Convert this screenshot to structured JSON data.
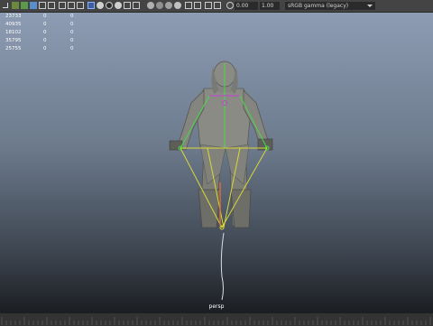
{
  "toolbar": {
    "near_clip": "0.00",
    "far_clip": "1.00",
    "color_space": "sRGB gamma (legacy)"
  },
  "hud": {
    "rows": [
      {
        "value": "23733",
        "col1": "0",
        "col2": "0"
      },
      {
        "value": "40935",
        "col1": "0",
        "col2": "0"
      },
      {
        "value": "18102",
        "col1": "0",
        "col2": "0"
      },
      {
        "value": "35795",
        "col1": "0",
        "col2": "0"
      },
      {
        "value": "25755",
        "col1": "0",
        "col2": "0"
      }
    ]
  },
  "viewport": {
    "camera_label": "persp"
  },
  "colors": {
    "toolbar_bg": "#444444",
    "viewport_top": "#8d9cb3",
    "viewport_bottom": "#1b1e22",
    "character": "#8b8b85",
    "joint_yellow": "#d8d838",
    "joint_green": "#48d848",
    "joint_magenta": "#c040d0"
  },
  "icons": [
    "select-tool-icon",
    "lasso-icon",
    "paint-icon",
    "move-icon",
    "rotate-icon",
    "scale-icon",
    "grid-icon",
    "camera-icon",
    "wireframe-icon",
    "shaded-icon",
    "texture-icon",
    "light-icon",
    "shadow-icon",
    "xray-icon",
    "isolate-icon",
    "resolution-gate-icon",
    "gamma-icon"
  ]
}
